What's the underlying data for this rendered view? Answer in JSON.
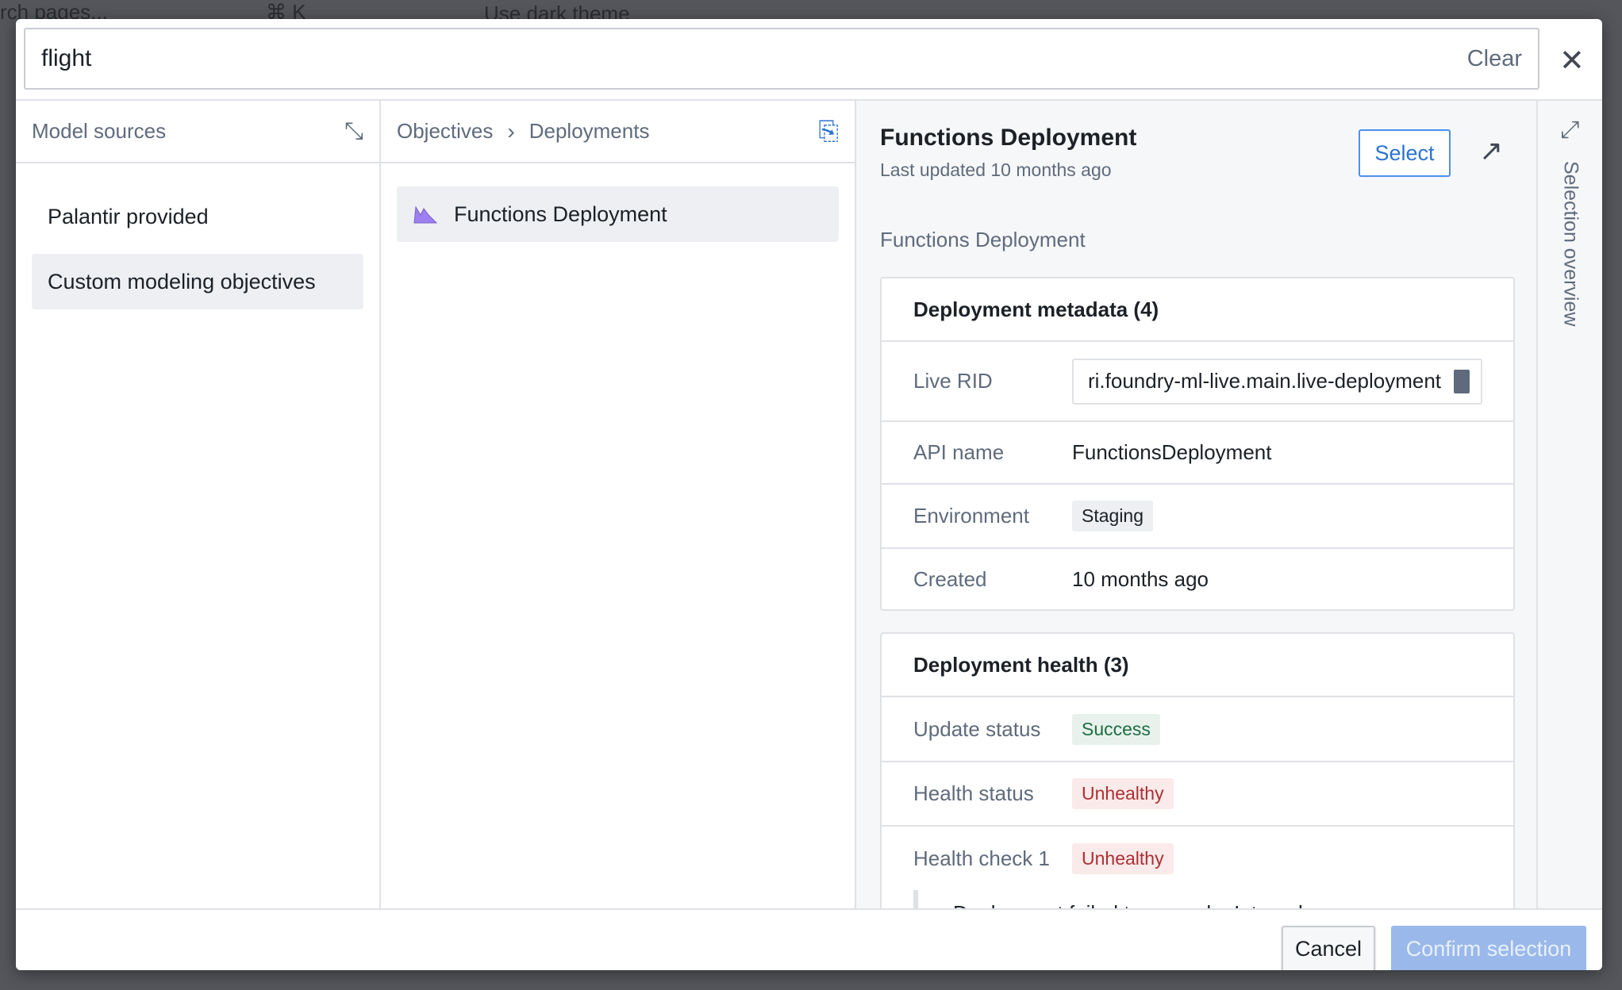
{
  "background": {
    "search_hint": "rch pages...",
    "shortcut": "⌘ K",
    "dark_theme_label": "Use dark theme"
  },
  "search": {
    "value": "flight",
    "clear_label": "Clear"
  },
  "sources": {
    "title": "Model sources",
    "items": [
      {
        "label": "Palantir provided"
      },
      {
        "label": "Custom modeling objectives",
        "selected": true
      }
    ]
  },
  "browser": {
    "breadcrumb": [
      "Objectives",
      "Deployments"
    ],
    "items": [
      {
        "label": "Functions Deployment",
        "selected": true
      }
    ]
  },
  "detail": {
    "title": "Functions Deployment",
    "updated": "Last updated 10 months ago",
    "select_label": "Select",
    "subtitle": "Functions Deployment",
    "metadata": {
      "title": "Deployment metadata (4)",
      "live_rid_label": "Live RID",
      "live_rid": "ri.foundry-ml-live.main.live-deployment",
      "api_label": "API name",
      "api": "FunctionsDeployment",
      "env_label": "Environment",
      "env": "Staging",
      "created_label": "Created",
      "created": "10 months ago"
    },
    "health": {
      "title": "Deployment health (3)",
      "update_label": "Update status",
      "update": "Success",
      "health_label": "Health status",
      "health": "Unhealthy",
      "check_label": "Health check 1",
      "check": "Unhealthy",
      "error": "Deployment failed to upgrade: Internal error"
    }
  },
  "rail": {
    "label": "Selection overview"
  },
  "footer": {
    "cancel": "Cancel",
    "confirm": "Confirm selection"
  },
  "colors": {
    "accent": "#2d72d2",
    "success_bg": "#e8f1ec",
    "success_fg": "#1c6e42",
    "danger_bg": "#fbeaea",
    "danger_fg": "#ac2f33",
    "icon_purple": "#9d7ff0"
  }
}
